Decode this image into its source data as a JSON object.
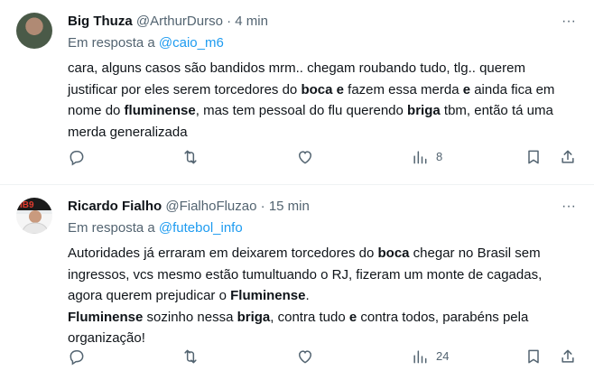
{
  "tweets": [
    {
      "name": "Big Thuza",
      "handle": "@ArthurDurso",
      "sep": "·",
      "time": "4 min",
      "reply_prefix": "Em resposta a",
      "reply_to": "@caio_m6",
      "body_parts": [
        {
          "text": "cara, alguns casos são bandidos mrm.. chegam roubando tudo, tlg.. querem justificar por eles serem torcedores do ",
          "bold": false
        },
        {
          "text": "boca",
          "bold": true
        },
        {
          "text": " ",
          "bold": false
        },
        {
          "text": "e",
          "bold": true
        },
        {
          "text": " fazem essa merda ",
          "bold": false
        },
        {
          "text": "e",
          "bold": true
        },
        {
          "text": " ainda fica em nome do ",
          "bold": false
        },
        {
          "text": "fluminense",
          "bold": true
        },
        {
          "text": ", mas tem pessoal do flu querendo ",
          "bold": false
        },
        {
          "text": "briga",
          "bold": true
        },
        {
          "text": " tbm, então tá uma merda generalizada",
          "bold": false
        }
      ],
      "views": "8",
      "icons": [
        "reply-icon",
        "retweet-icon",
        "like-icon",
        "views-icon",
        "bookmark-icon",
        "share-icon"
      ]
    },
    {
      "name": "Ricardo Fialho",
      "handle": "@FialhoFluzao",
      "sep": "·",
      "time": "15 min",
      "reply_prefix": "Em resposta a",
      "reply_to": "@futebol_info",
      "body_parts": [
        {
          "text": "Autoridades já erraram em deixarem torcedores do ",
          "bold": false
        },
        {
          "text": "boca",
          "bold": true
        },
        {
          "text": " chegar no Brasil sem ingressos, vcs mesmo estão tumultuando o RJ, fizeram um monte de cagadas, agora querem prejudicar o ",
          "bold": false
        },
        {
          "text": "Fluminense",
          "bold": true
        },
        {
          "text": ".\n",
          "bold": false
        },
        {
          "text": "Fluminense",
          "bold": true
        },
        {
          "text": " sozinho nessa ",
          "bold": false
        },
        {
          "text": "briga",
          "bold": true
        },
        {
          "text": ", contra tudo ",
          "bold": false
        },
        {
          "text": "e",
          "bold": true
        },
        {
          "text": " contra todos, parabéns pela organização!",
          "bold": false
        }
      ],
      "views": "24",
      "icons": [
        "reply-icon",
        "retweet-icon",
        "like-icon",
        "views-icon",
        "bookmark-icon",
        "share-icon"
      ]
    }
  ],
  "more_symbol": "···",
  "colors": {
    "text": "#0f1419",
    "secondary": "#536471",
    "accent": "#1d9bf0",
    "divider": "#eff3f4"
  }
}
